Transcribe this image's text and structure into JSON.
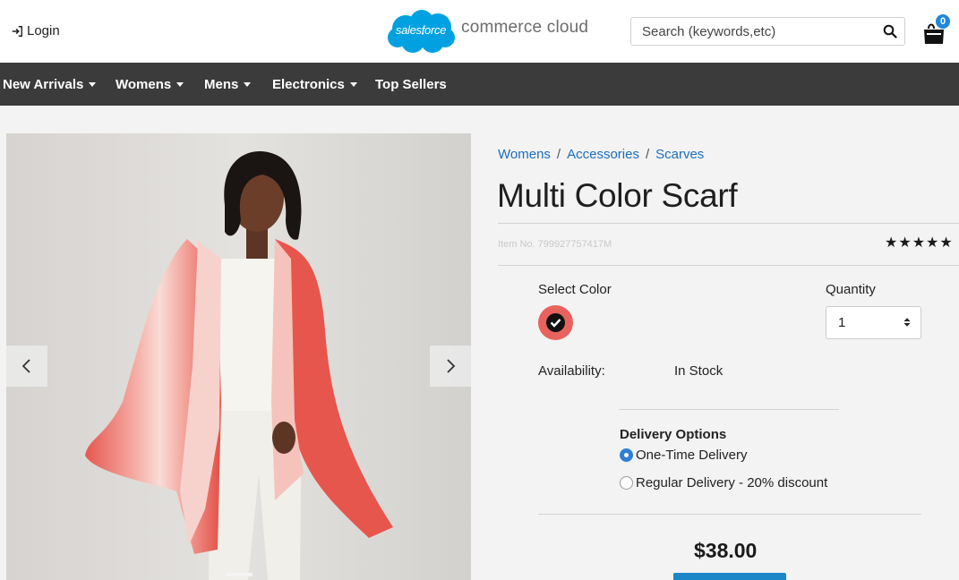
{
  "header": {
    "login_label": "Login",
    "logo_text": "salesforce",
    "logo_tagline": "commerce cloud",
    "search_placeholder": "Search (keywords,etc)",
    "cart_count": "0",
    "brand_blue": "#00a1e0",
    "badge_color": "#1e88d8"
  },
  "nav": {
    "items": [
      {
        "label": "New Arrivals",
        "has_dropdown": true
      },
      {
        "label": "Womens",
        "has_dropdown": true
      },
      {
        "label": "Mens",
        "has_dropdown": true
      },
      {
        "label": "Electronics",
        "has_dropdown": true
      },
      {
        "label": "Top Sellers",
        "has_dropdown": false
      }
    ],
    "background": "#3b3b3b"
  },
  "carousel": {
    "prev_icon": "chevron-left-icon",
    "next_icon": "chevron-right-icon"
  },
  "product": {
    "breadcrumb": [
      {
        "label": "Womens"
      },
      {
        "label": "Accessories"
      },
      {
        "label": "Scarves"
      }
    ],
    "breadcrumb_separator": "/",
    "name": "Multi Color Scarf",
    "item_number": "Item No. 799927757417M",
    "rating": 4.5,
    "rating_max": 5,
    "select_color_label": "Select Color",
    "selected_color": "#e8635d",
    "quantity_label": "Quantity",
    "quantity_value": "1",
    "availability_label": "Availability:",
    "availability_value": "In Stock",
    "delivery": {
      "title": "Delivery Options",
      "options": [
        {
          "label": "One-Time Delivery",
          "selected": true
        },
        {
          "label": "Regular Delivery - 20% discount",
          "selected": false
        }
      ]
    },
    "price": "$38.00",
    "link_color": "#1c6ebc",
    "button_color": "#1b87c9"
  }
}
